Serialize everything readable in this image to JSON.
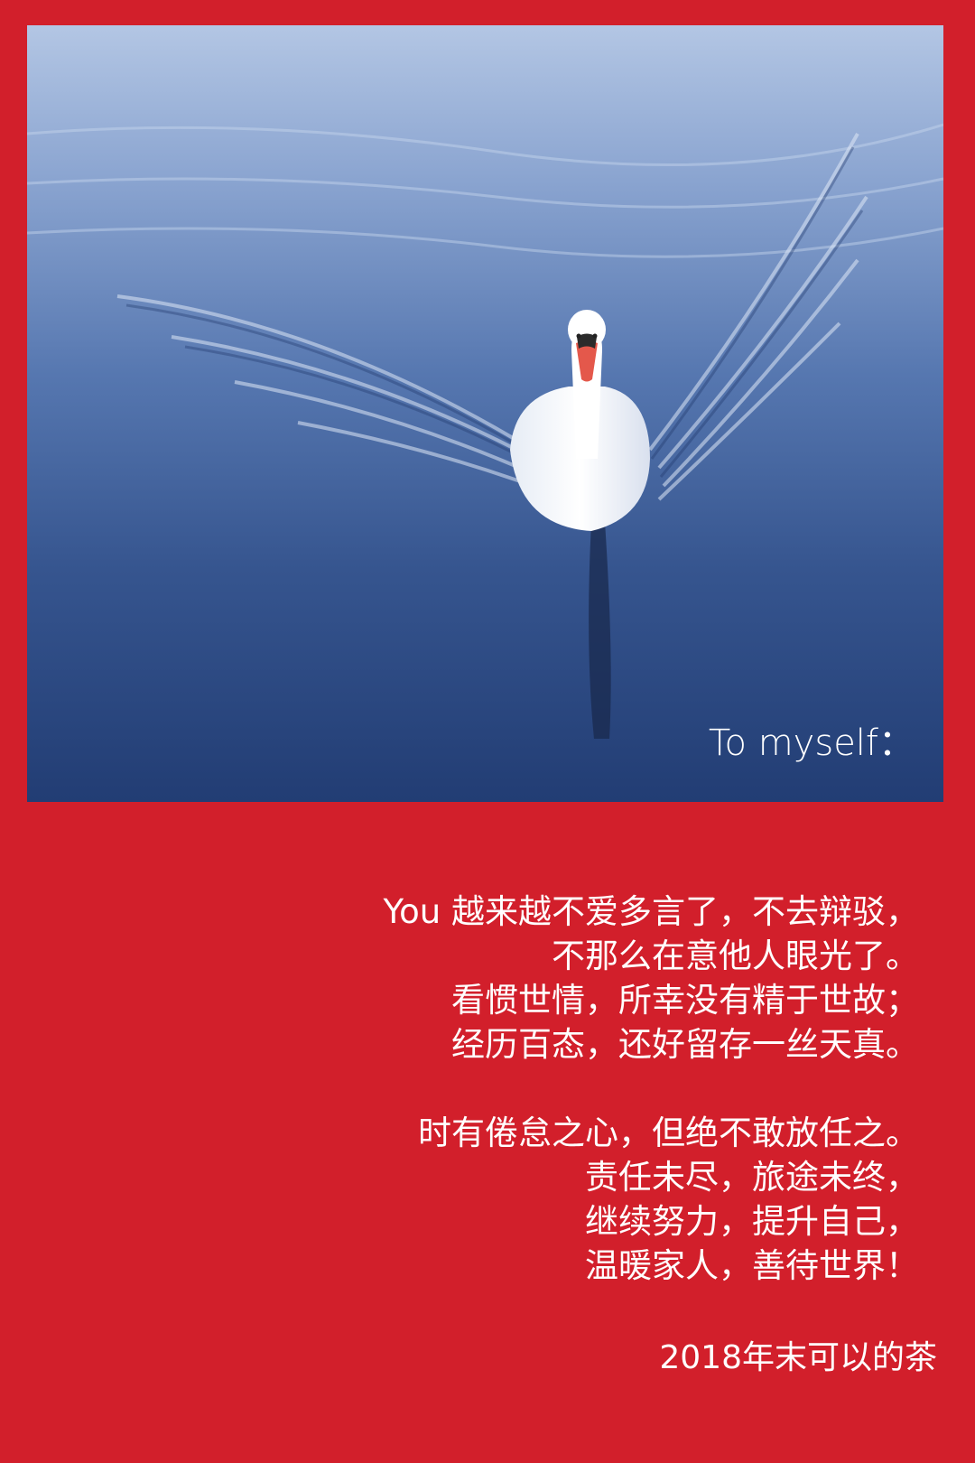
{
  "photo": {
    "subject": "white swan swimming on blue water",
    "caption": "To myself："
  },
  "poem": {
    "stanza1": [
      "You 越来越不爱多言了，不去辩驳，",
      "不那么在意他人眼光了。",
      "看惯世情，所幸没有精于世故；",
      "经历百态，还好留存一丝天真。"
    ],
    "stanza2": [
      "时有倦怠之心，但绝不敢放任之。",
      "责任未尽，旅途未终，",
      "继续努力，提升自己，",
      "温暖家人，善待世界！"
    ]
  },
  "signature": "2018年末可以的茶",
  "colors": {
    "background": "#d21f2b",
    "text": "#ffffff",
    "water": "#3f5f9a"
  }
}
